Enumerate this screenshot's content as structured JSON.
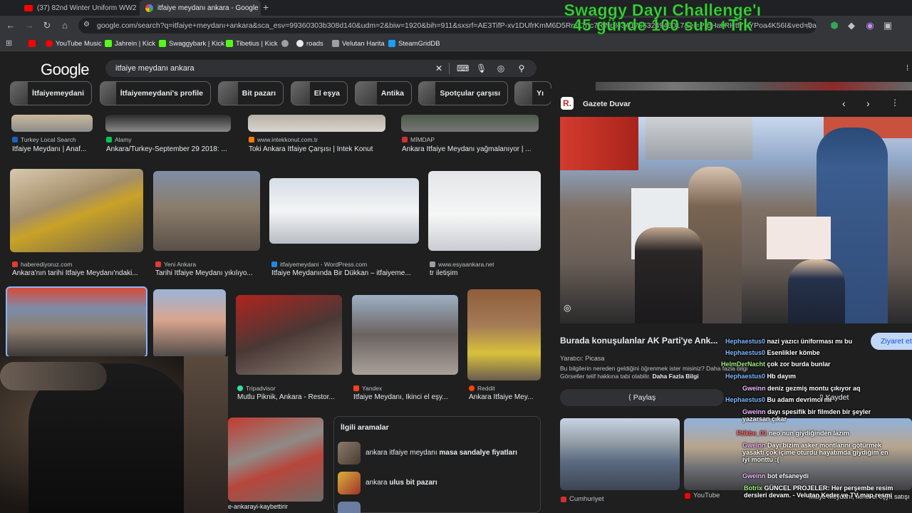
{
  "tabs": [
    {
      "title": "(37) 82nd Winter Uniform WW2",
      "active": false
    },
    {
      "title": "itfaiye meydanı ankara - Google",
      "active": true
    }
  ],
  "new_tab": "+",
  "address": "google.com/search?q=itfaiye+meydanı+ankara&sca_esv=99360303b308d140&udm=2&biw=1920&bih=911&sxsrf=AE3TifP-xv1DUfrKmM6D5RmtlTrfc7RlNg%3A1766324945017&ei=P-bHaflRHtf7NYPoa4K56I&ved=0ahUK...",
  "bookmarks": [
    "YouTube Music",
    "Jahrein | Kick",
    "Swaggybark | Kick",
    "Tibetius | Kick",
    "roads",
    "Velutan Harita",
    "SteamGridDB"
  ],
  "overlay": {
    "line1": "Swaggy Dayı Challenge'ı",
    "line2": "45 günde 100 sub +Tik"
  },
  "google": {
    "logo": "Google",
    "query": "itfaiye meydanı ankara"
  },
  "chips": [
    "İtfaiyemeydani",
    "İtfaiyemeydani's profile",
    "Bit pazarı",
    "El eşya",
    "Antika",
    "Spotçular çarşısı",
    "Yı"
  ],
  "row1": [
    {
      "source": "Turkey Local Search",
      "caption": "İtfaiye Meydanı | Anaf..."
    },
    {
      "source": "Alamy",
      "caption": "Ankara/Turkey-September 29 2018: ..."
    },
    {
      "source": "www.intekkonut.com.tr",
      "caption": "Toki Ankara İtfaiye Çarşısı | İntek Konut"
    },
    {
      "source": "MİMDAP",
      "caption": "Ankara İtfaiye Meydanı yağmalanıyor | ..."
    }
  ],
  "row2": [
    {
      "source": "haberediyoruz.com",
      "caption": "Ankara'nın tarihi İtfaiye Meydanı'ndaki..."
    },
    {
      "source": "Yeni Ankara",
      "caption": "Tarihi İtfaiye Meydanı yıkılıyo..."
    },
    {
      "source": "itfaiyemeydani - WordPress.com",
      "caption": "İtfaiye Meydanında Bir Dükkan – itfaiyeme..."
    },
    {
      "source": "www.esyaankara.net",
      "caption": "tr iletişim"
    }
  ],
  "row3": [
    {
      "source": "Tripadvisor",
      "caption": "Mutlu Piknik, Ankara - Restor..."
    },
    {
      "source": "Yandex",
      "caption": "İtfaiye Meydanı, İkinci el eşy..."
    },
    {
      "source": "Reddit",
      "caption": "Ankara İtfaiye Mey..."
    }
  ],
  "row4_caption": "e-ankarayi-kaybettirir",
  "related": {
    "title": "İlgili aramalar",
    "items": [
      {
        "prefix": "ankara itfaiye meydanı ",
        "bold": "masa sandalye fiyatları"
      },
      {
        "prefix": "ankara ",
        "bold": "ulus bit pazarı"
      }
    ]
  },
  "panel": {
    "source": "Gazete Duvar",
    "logo_letter": "R.",
    "title": "Burada konuşulanlar AK Parti'ye Ank...",
    "creator": "Yaratıcı: Picasa",
    "license_line1": "Bu bilgilerin nereden geldiğini öğrenmek ister misiniz? Daha fazla bilgi",
    "license_line2": "Görseller telif hakkına tabi olabilir.",
    "license_link": "Daha Fazla Bilgi",
    "visit": "Ziyaret et",
    "share": "Paylaş",
    "save": "Kaydet",
    "related_sources": [
      "Cumhuriyet",
      "YouTube"
    ],
    "right_caption": "İtfaiye Meydanı, İkinci el eşya satışı"
  },
  "chat": [
    {
      "user": "Hephaestus0",
      "text": "nazi yazıcı üniforması mı bu"
    },
    {
      "user": "Hephaestus0",
      "text": "Esenlikler kömbe"
    },
    {
      "user": "HelmDerNacht",
      "text": "çok zor burda bunlar"
    },
    {
      "user": "Hephaestus0",
      "text": "Hb dayım"
    },
    {
      "user": "Gweinn",
      "text": "deniz gezmiş montu çıkıyor aq"
    },
    {
      "user": "Hephaestus0",
      "text": "Bu adam devrimci mi"
    },
    {
      "user": "Gweinn",
      "text": "dayı spesifik bir filmden bir şeyler yazarsan çıkar"
    },
    {
      "user": "Rtikbe_01",
      "text": "neo nun giydiğinden lazım"
    },
    {
      "user": "Gweinn",
      "text": "Dayı bizim asker montlarını götürmek yasaktı çok içime oturdu hayatımda giydiğim en iyi monttu :("
    },
    {
      "user": "Gweinn",
      "text": "bot efsaneydi"
    },
    {
      "user": "Botrix",
      "text": "GÜNCEL PROJELER: Her perşembe resim dersleri devam. - Velutan Keder ve TV map resmi"
    }
  ],
  "colors": {
    "overlay_green": "#3ecf3e",
    "accent_blue": "#8ab4f8"
  }
}
